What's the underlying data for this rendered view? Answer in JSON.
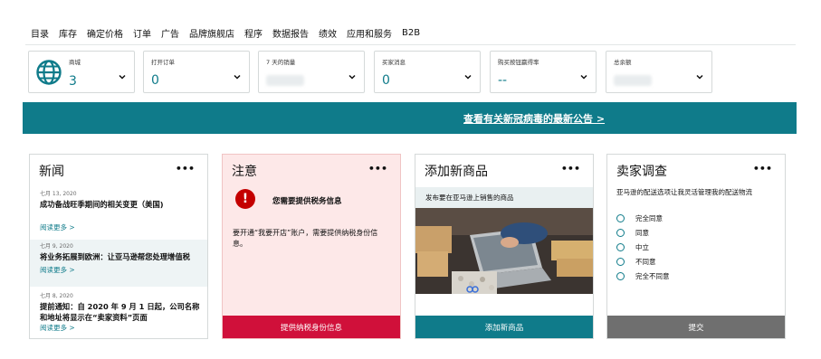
{
  "nav": [
    "目录",
    "库存",
    "确定价格",
    "订单",
    "广告",
    "品牌旗舰店",
    "程序",
    "数据报告",
    "绩效",
    "应用和服务",
    "B2B"
  ],
  "metrics": [
    {
      "label": "商城",
      "value": "3",
      "icon": "globe-icon"
    },
    {
      "label": "打开订单",
      "value": "0"
    },
    {
      "label": "7 天的销量",
      "value": ""
    },
    {
      "label": "买家消息",
      "value": "0"
    },
    {
      "label": "购买按钮赢得率",
      "value": "--"
    },
    {
      "label": "总余额",
      "value": ""
    }
  ],
  "banner": {
    "link": "查看有关新冠病毒的最新公告 >"
  },
  "news": {
    "title": "新闻",
    "menu": "•••",
    "items": [
      {
        "date": "七月 13, 2020",
        "title": "成功备战旺季期间的相关变更（美国)",
        "more": "阅读更多 >"
      },
      {
        "date": "七月 9, 2020",
        "title": "将业务拓展到欧洲：让亚马逊帮您处理增值税",
        "more": "阅读更多 >"
      },
      {
        "date": "七月 8, 2020",
        "title": "提前通知：自 2020 年 9 月 1 日起，公司名称和地址将显示在“卖家资料”页面",
        "more": "阅读更多 >"
      }
    ]
  },
  "notice": {
    "title": "注意",
    "menu": "•••",
    "icon_glyph": "!",
    "heading": "您需要提供税务信息",
    "body": "要开通“我要开店”账户，需要提供纳税身份信息。",
    "button": "提供纳税身份信息"
  },
  "add_product": {
    "title": "添加新商品",
    "menu": "•••",
    "subtitle": "发布要在亚马逊上销售的商品",
    "button": "添加新商品"
  },
  "survey": {
    "title": "卖家调查",
    "menu": "•••",
    "question": "亚马逊的配送选项让我灵活管理我的配送物流",
    "options": [
      "完全同意",
      "同意",
      "中立",
      "不同意",
      "完全不同意"
    ],
    "button": "提交"
  },
  "colors": {
    "teal": "#0f7b8a",
    "alert_red": "#c40000",
    "notice_bg": "#fde8e8",
    "crimson_button": "#d0103a",
    "gray_button": "#6f6f6f"
  }
}
